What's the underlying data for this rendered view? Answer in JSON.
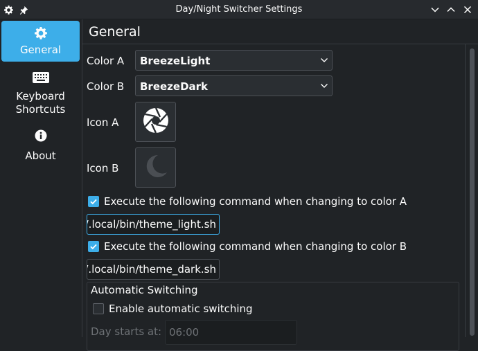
{
  "window": {
    "title": "Day/Night Switcher Settings",
    "left_icons": [
      "gear-icon",
      "pin-icon"
    ],
    "right_icons": [
      "chevron-down-icon",
      "chevron-up-icon",
      "close-icon"
    ]
  },
  "sidebar": {
    "items": [
      {
        "label": "General",
        "icon": "gear-icon",
        "active": true
      },
      {
        "label": "Keyboard Shortcuts",
        "label_line1": "Keyboard",
        "label_line2": "Shortcuts",
        "icon": "keyboard-icon",
        "active": false
      },
      {
        "label": "About",
        "icon": "info-icon",
        "active": false
      }
    ]
  },
  "page": {
    "title": "General"
  },
  "settings": {
    "color_a": {
      "label": "Color A",
      "value": "BreezeLight"
    },
    "color_b": {
      "label": "Color B",
      "value": "BreezeDark"
    },
    "icon_a": {
      "label": "Icon A",
      "icon": "aperture-icon"
    },
    "icon_b": {
      "label": "Icon B",
      "icon": "moon-icon"
    },
    "exec_a": {
      "label": "Execute the following command when changing to color A",
      "checked": true,
      "command": "~/.local/bin/theme_light.sh"
    },
    "exec_b": {
      "label": "Execute the following command when changing to color B",
      "checked": true,
      "command": "~/.local/bin/theme_dark.sh"
    },
    "auto": {
      "group_title": "Automatic Switching",
      "enable_label": "Enable automatic switching",
      "enabled": false,
      "day_label": "Day starts at:",
      "day_value": "06:00"
    }
  },
  "colors": {
    "accent": "#3daee9",
    "background": "#202326",
    "field": "#2a2e32",
    "text": "#fcfcfc"
  }
}
